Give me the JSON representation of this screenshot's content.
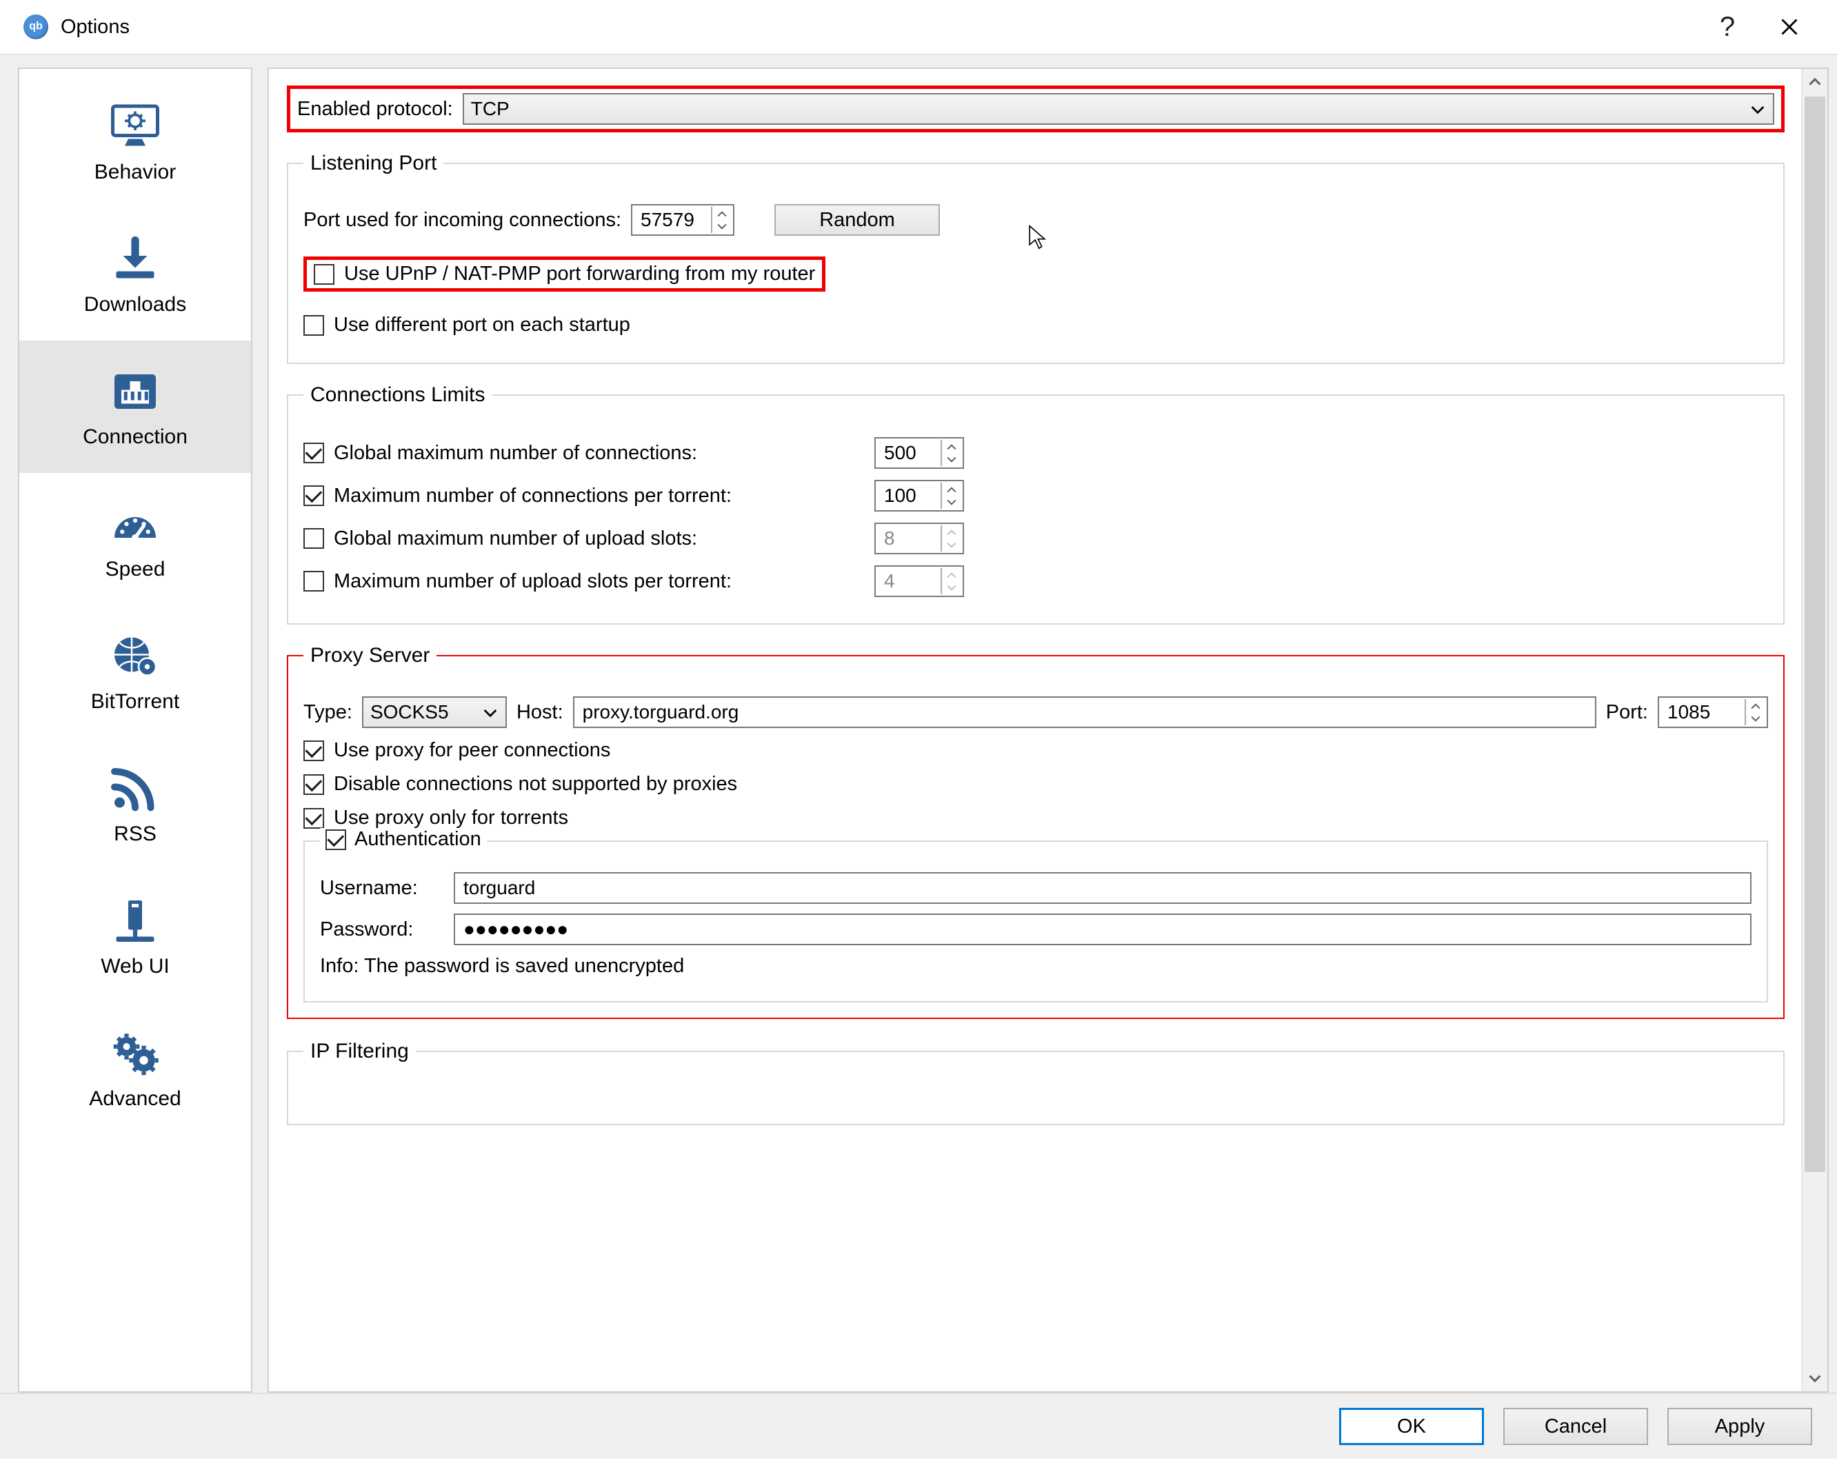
{
  "window": {
    "title": "Options"
  },
  "sidebar": {
    "items": [
      {
        "label": "Behavior"
      },
      {
        "label": "Downloads"
      },
      {
        "label": "Connection"
      },
      {
        "label": "Speed"
      },
      {
        "label": "BitTorrent"
      },
      {
        "label": "RSS"
      },
      {
        "label": "Web UI"
      },
      {
        "label": "Advanced"
      }
    ]
  },
  "protocol": {
    "label": "Enabled protocol:",
    "value": "TCP"
  },
  "listening": {
    "legend": "Listening Port",
    "port_label": "Port used for incoming connections:",
    "port_value": "57579",
    "random_btn": "Random",
    "upnp_label": "Use UPnP / NAT-PMP port forwarding from my router",
    "diffport_label": "Use different port on each startup"
  },
  "limits": {
    "legend": "Connections Limits",
    "r1": {
      "label": "Global maximum number of connections:",
      "value": "500"
    },
    "r2": {
      "label": "Maximum number of connections per torrent:",
      "value": "100"
    },
    "r3": {
      "label": "Global maximum number of upload slots:",
      "value": "8"
    },
    "r4": {
      "label": "Maximum number of upload slots per torrent:",
      "value": "4"
    }
  },
  "proxy": {
    "legend": "Proxy Server",
    "type_label": "Type:",
    "type_value": "SOCKS5",
    "host_label": "Host:",
    "host_value": "proxy.torguard.org",
    "port_label": "Port:",
    "port_value": "1085",
    "peer_label": "Use proxy for peer connections",
    "disable_label": "Disable connections not supported by proxies",
    "only_torrents_label": "Use proxy only for torrents",
    "auth_label": "Authentication",
    "user_label": "Username:",
    "user_value": "torguard",
    "pass_label": "Password:",
    "pass_value": "●●●●●●●●●",
    "info_text": "Info: The password is saved unencrypted"
  },
  "ipfilter": {
    "legend": "IP Filtering"
  },
  "footer": {
    "ok": "OK",
    "cancel": "Cancel",
    "apply": "Apply"
  }
}
